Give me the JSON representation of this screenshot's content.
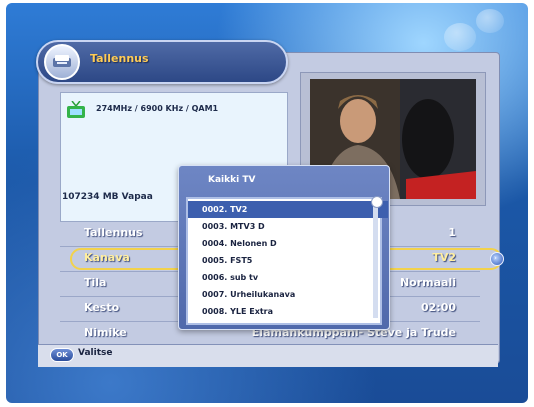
{
  "header": {
    "title": "Tallennus"
  },
  "info": {
    "frequency": "274MHz / 6900 KHz / QAM1",
    "free_space": "107234 MB Vapaa"
  },
  "settings": [
    {
      "label": "Tallennus",
      "value": "1"
    },
    {
      "label": "Kanava",
      "value": "TV2"
    },
    {
      "label": "Tila",
      "value": "Normaali"
    },
    {
      "label": "Kesto",
      "value": "02:00"
    },
    {
      "label": "Nimike",
      "value": "Elämänkumppani- Steve ja Trude"
    }
  ],
  "popup": {
    "title": "Kaikki TV",
    "items": [
      "0002. TV2",
      "0003. MTV3 D",
      "0004. Nelonen D",
      "0005. FST5",
      "0006. sub tv",
      "0007. Urheilukanava",
      "0008. YLE Extra"
    ],
    "selected_index": 0
  },
  "footer": {
    "ok_badge": "OK",
    "action_label": "Valitse"
  },
  "icons": {
    "header": "recording-device-icon",
    "info": "tv-icon",
    "right": "circle-arrow-icon"
  },
  "colors": {
    "accent": "#f2d24c",
    "header_bg": "#3b5796",
    "list_highlight": "#3d5fae"
  }
}
